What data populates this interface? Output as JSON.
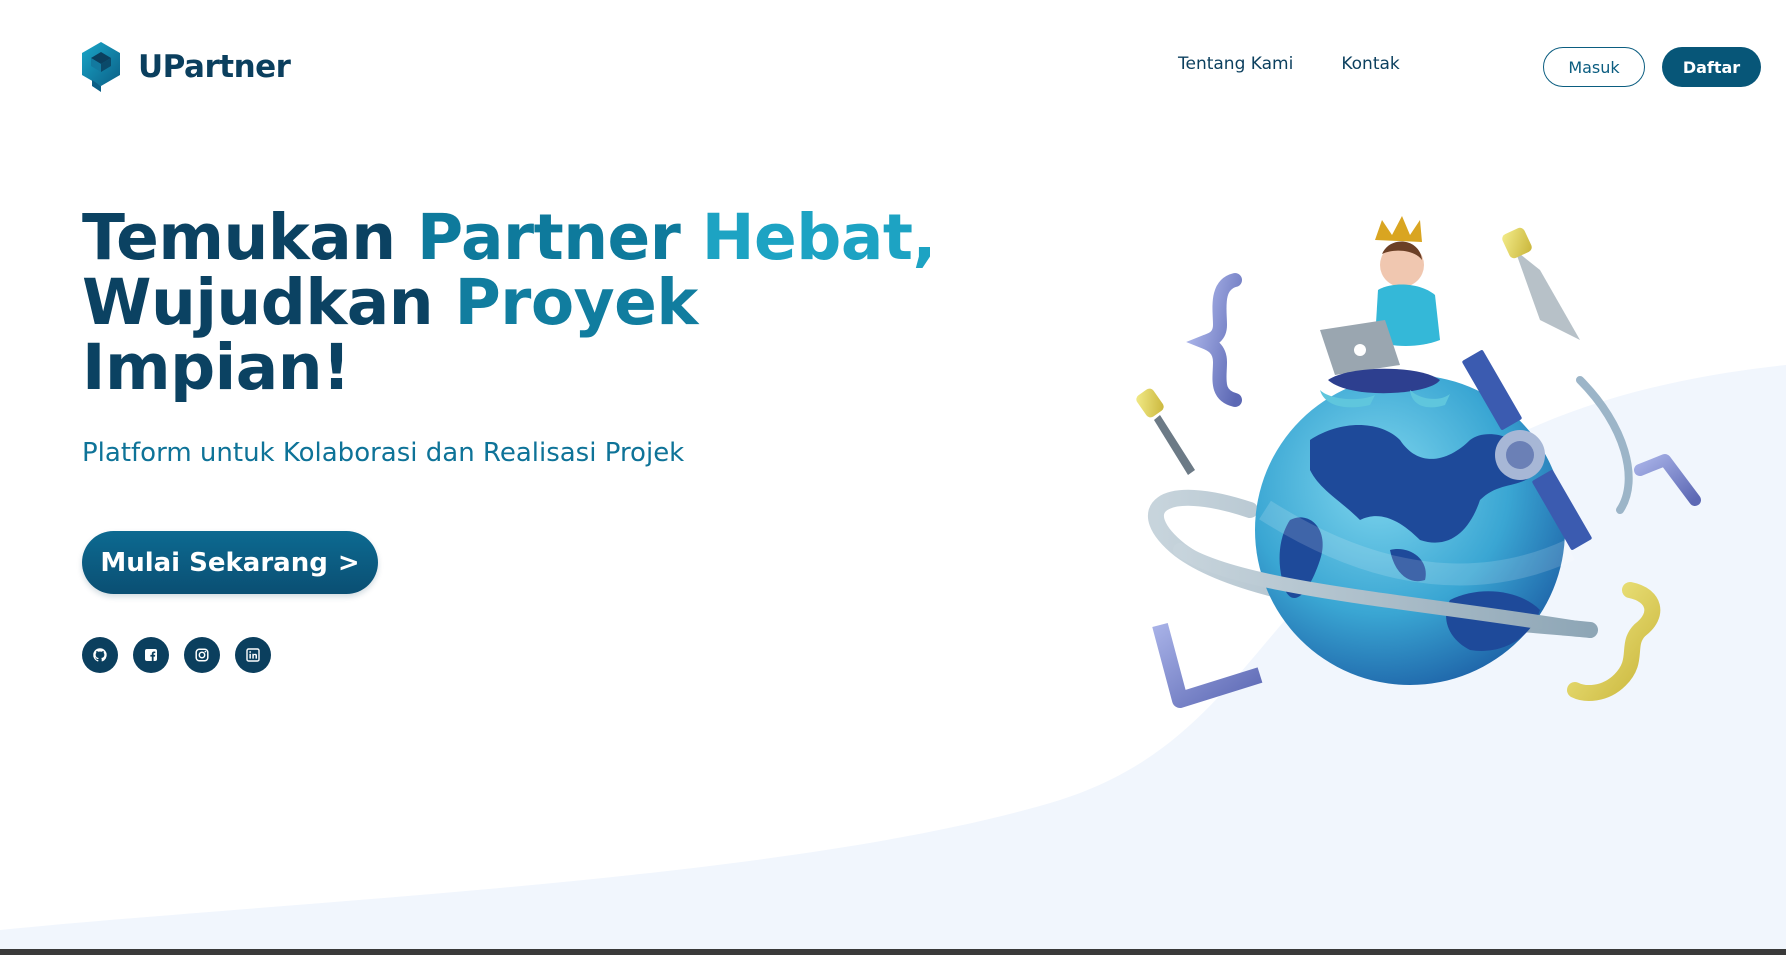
{
  "brand": {
    "name": "UPartner",
    "logo_icon": "hexagon-logo-icon",
    "colors": {
      "dark": "#0b4262",
      "teal": "#0e7a9c",
      "light_teal": "#1da3c3",
      "button": "#075678",
      "bg_curve": "#f1f6fd"
    }
  },
  "nav": {
    "items": [
      {
        "label": "Tentang Kami"
      },
      {
        "label": "Kontak"
      }
    ],
    "login_label": "Masuk",
    "register_label": "Daftar"
  },
  "hero": {
    "title_words": {
      "w1": "Temukan",
      "w2": "Partner",
      "w3": "Hebat,",
      "w4": "Wujudkan",
      "w5": "Proyek",
      "w6": "Impian!"
    },
    "subtitle": "Platform untuk Kolaborasi dan Realisasi Projek",
    "cta_label": "Mulai Sekarang",
    "cta_icon": ">"
  },
  "socials": [
    {
      "name": "github-icon"
    },
    {
      "name": "facebook-icon"
    },
    {
      "name": "instagram-icon"
    },
    {
      "name": "linkedin-icon"
    }
  ],
  "illustration": {
    "subject": "globe-with-person-laptop-illustration"
  }
}
